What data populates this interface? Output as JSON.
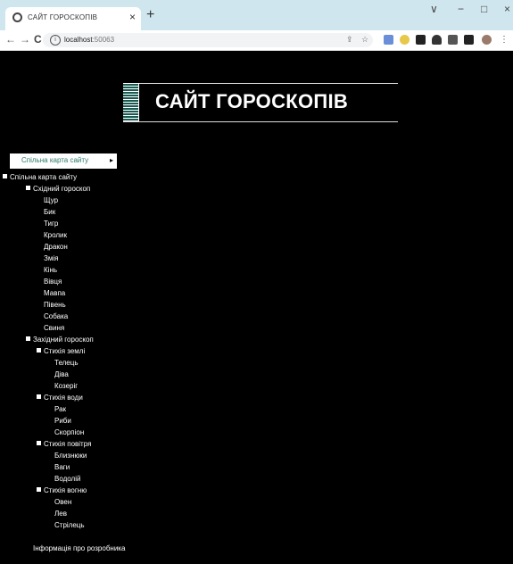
{
  "browser": {
    "tab_title": "САЙТ ГОРОСКОПІВ",
    "tab_close": "×",
    "new_tab": "+",
    "url_host": "localhost",
    "url_port": ":50063",
    "nav": {
      "back": "←",
      "forward": "→",
      "reload": "C"
    },
    "window": {
      "chevron": "∨",
      "minimize": "−",
      "maximize": "□",
      "close": "×"
    }
  },
  "page": {
    "title": "САЙТ ГОРОСКОПІВ",
    "menu_button": "Спільна карта сайту",
    "menu_arrow": "▸"
  },
  "sitemap": {
    "root": "Спільна карта сайту",
    "eastern": {
      "label": "Східний гороскоп",
      "items": [
        "Щур",
        "Бик",
        "Тигр",
        "Кролик",
        "Дракон",
        "Змія",
        "Кінь",
        "Вівця",
        "Мавпа",
        "Півень",
        "Собака",
        "Свиня"
      ]
    },
    "western": {
      "label": "Західний гороскоп",
      "earth": {
        "label": "Стихія землі",
        "items": [
          "Телець",
          "Діва",
          "Козеріг"
        ]
      },
      "water": {
        "label": "Стихія води",
        "items": [
          "Рак",
          "Риби",
          "Скорпіон"
        ]
      },
      "air": {
        "label": "Стихія повітря",
        "items": [
          "Близнюки",
          "Ваги",
          "Водолій"
        ]
      },
      "fire": {
        "label": "Стихія вогню",
        "items": [
          "Овен",
          "Лев",
          "Стрілець"
        ]
      }
    },
    "developer": "Інформація про розробника"
  }
}
